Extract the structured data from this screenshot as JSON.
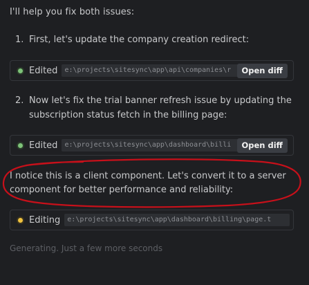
{
  "intro": "I'll help you fix both issues:",
  "steps": [
    {
      "num": "1.",
      "text": "First, let's update the company creation redirect:"
    },
    {
      "num": "2.",
      "text": "Now let's fix the trial banner refresh issue by updating the subscription status fetch in the billing page:"
    }
  ],
  "edits": [
    {
      "status": "Edited",
      "path": "e:\\projects\\sitesync\\app\\api\\companies\\r",
      "button": "Open diff"
    },
    {
      "status": "Edited",
      "path": "e:\\projects\\sitesync\\app\\dashboard\\billi",
      "button": "Open diff"
    },
    {
      "status": "Editing",
      "path": "e:\\projects\\sitesync\\app\\dashboard\\billing\\page.t"
    }
  ],
  "notice": "I notice this is a client component. Let's convert it to a server component for better performance and reliability:",
  "generating": "Generating. Just a few more seconds",
  "colors": {
    "edited_dot": "#7ec379",
    "editing_dot": "#f0c23f",
    "annotation": "#c8101a"
  }
}
